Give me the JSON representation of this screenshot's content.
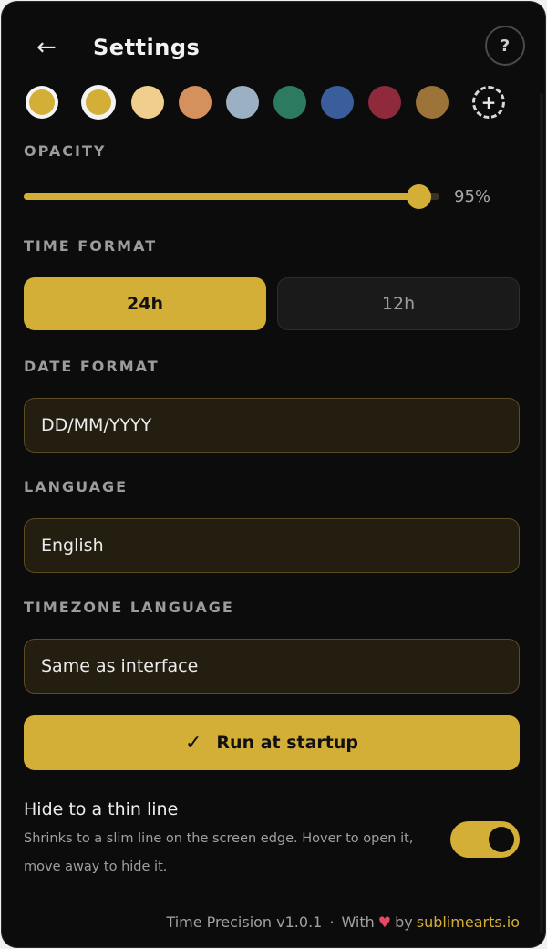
{
  "header": {
    "back_icon": "←",
    "title": "Settings",
    "help_icon": "?"
  },
  "swatches": [
    {
      "color": "#d4af37",
      "ring": "white"
    },
    {
      "color": "#d4af37",
      "ring": "light"
    },
    {
      "color": "#f0cf8e",
      "ring": ""
    },
    {
      "color": "#d4915e",
      "ring": ""
    },
    {
      "color": "#9bb0c2",
      "ring": ""
    },
    {
      "color": "#2c7a5f",
      "ring": ""
    },
    {
      "color": "#3a5e9c",
      "ring": ""
    },
    {
      "color": "#8e2a3c",
      "ring": ""
    },
    {
      "color": "#9c7338",
      "ring": ""
    }
  ],
  "swatch_add_icon": "+",
  "opacity": {
    "label": "OPACITY",
    "value": 0.95,
    "value_text": "95%"
  },
  "time_format": {
    "label": "TIME FORMAT",
    "options": [
      "24h",
      "12h"
    ],
    "selected": "24h"
  },
  "date_format": {
    "label": "DATE FORMAT",
    "value": "DD/MM/YYYY"
  },
  "language": {
    "label": "LANGUAGE",
    "value": "English"
  },
  "timezone_language": {
    "label": "TIMEZONE LANGUAGE",
    "value": "Same as interface"
  },
  "startup": {
    "check_icon": "✓",
    "label": "Run at startup"
  },
  "hide_line": {
    "title": "Hide to a thin line",
    "description": "Shrinks to a slim line on the screen edge. Hover to open it, move away to hide it.",
    "enabled": true
  },
  "footer": {
    "app_version": "Time Precision v1.0.1",
    "separator": "·",
    "with_text": "With",
    "heart_icon": "♥",
    "by_text": "by",
    "link_text": "sublimearts.io"
  },
  "colors": {
    "accent": "#d4af37",
    "background": "#0c0c0c",
    "field_bg": "#231e10",
    "heart": "#e8476a"
  }
}
